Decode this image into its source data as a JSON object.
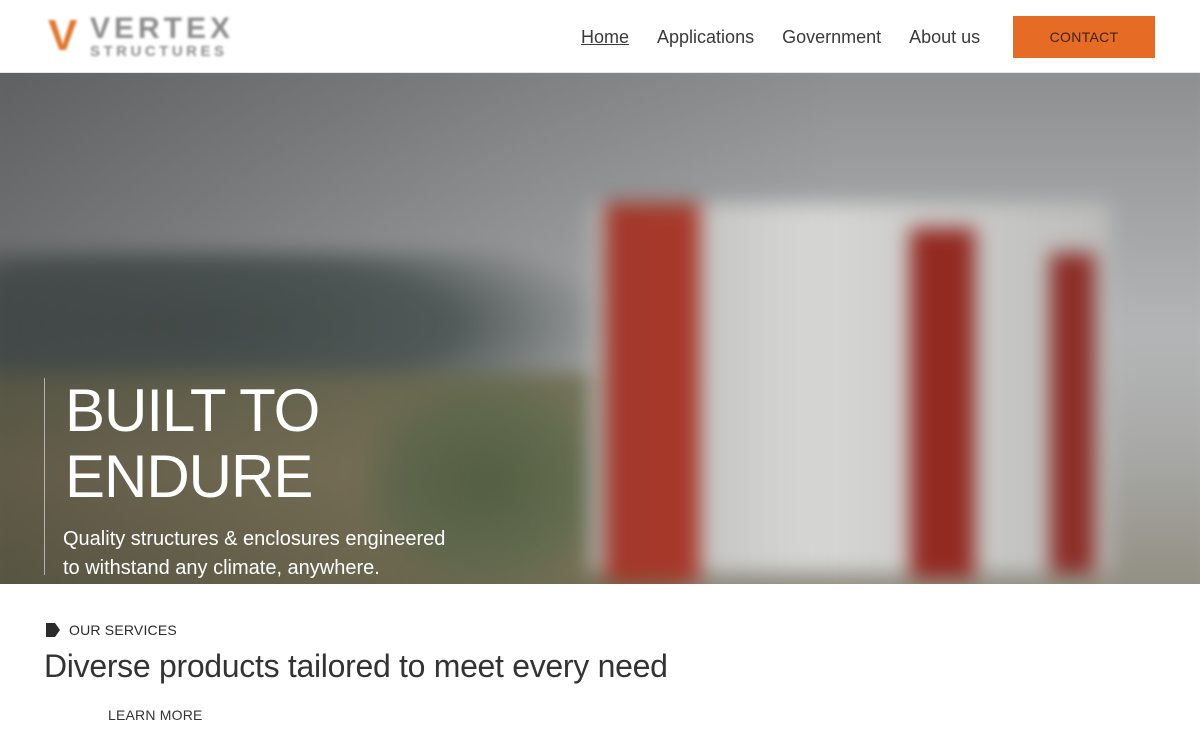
{
  "logo": {
    "letter": "V",
    "word": "VERTEX",
    "sub": "STRUCTURES"
  },
  "nav": {
    "items": [
      {
        "label": "Home"
      },
      {
        "label": "Applications"
      },
      {
        "label": "Government"
      },
      {
        "label": "About us"
      }
    ],
    "contact_label": "CONTACT"
  },
  "hero": {
    "title_line1": "BUILT TO",
    "title_line2": "ENDURE",
    "subtitle_line1": "Quality structures & enclosures engineered",
    "subtitle_line2": "to withstand any climate, anywhere."
  },
  "services": {
    "tag": "OUR SERVICES",
    "heading": "Diverse products tailored to meet every need",
    "learn_more": "LEARN MORE"
  },
  "colors": {
    "accent": "#e66b25",
    "logo_accent": "#e0782f",
    "text": "#333333"
  }
}
